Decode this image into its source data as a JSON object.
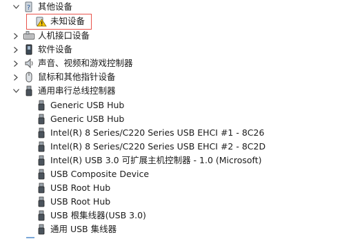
{
  "tree": {
    "other_devices": {
      "label": "其他设备",
      "expanded": true
    },
    "unknown_device": {
      "label": "未知设备",
      "icon": "warning-icon",
      "highlight_color": "#e8524a"
    },
    "hid": {
      "label": "人机接口设备"
    },
    "software_devices": {
      "label": "软件设备"
    },
    "audio": {
      "label": "声音、视频和游戏控制器"
    },
    "mice": {
      "label": "鼠标和其他指针设备"
    },
    "usb_controllers": {
      "label": "通用串行总线控制器",
      "expanded": true
    },
    "usb_children": [
      {
        "label": "Generic USB Hub"
      },
      {
        "label": "Generic USB Hub"
      },
      {
        "label": "Intel(R) 8 Series/C220 Series USB EHCI #1 - 8C26"
      },
      {
        "label": "Intel(R) 8 Series/C220 Series USB EHCI #2 - 8C2D"
      },
      {
        "label": "Intel(R) USB 3.0 可扩展主机控制器 - 1.0 (Microsoft)"
      },
      {
        "label": "USB Composite Device"
      },
      {
        "label": "USB Root Hub"
      },
      {
        "label": "USB Root Hub"
      },
      {
        "label": "USB 根集线器(USB 3.0)"
      },
      {
        "label": "通用 USB 集线器"
      }
    ]
  }
}
